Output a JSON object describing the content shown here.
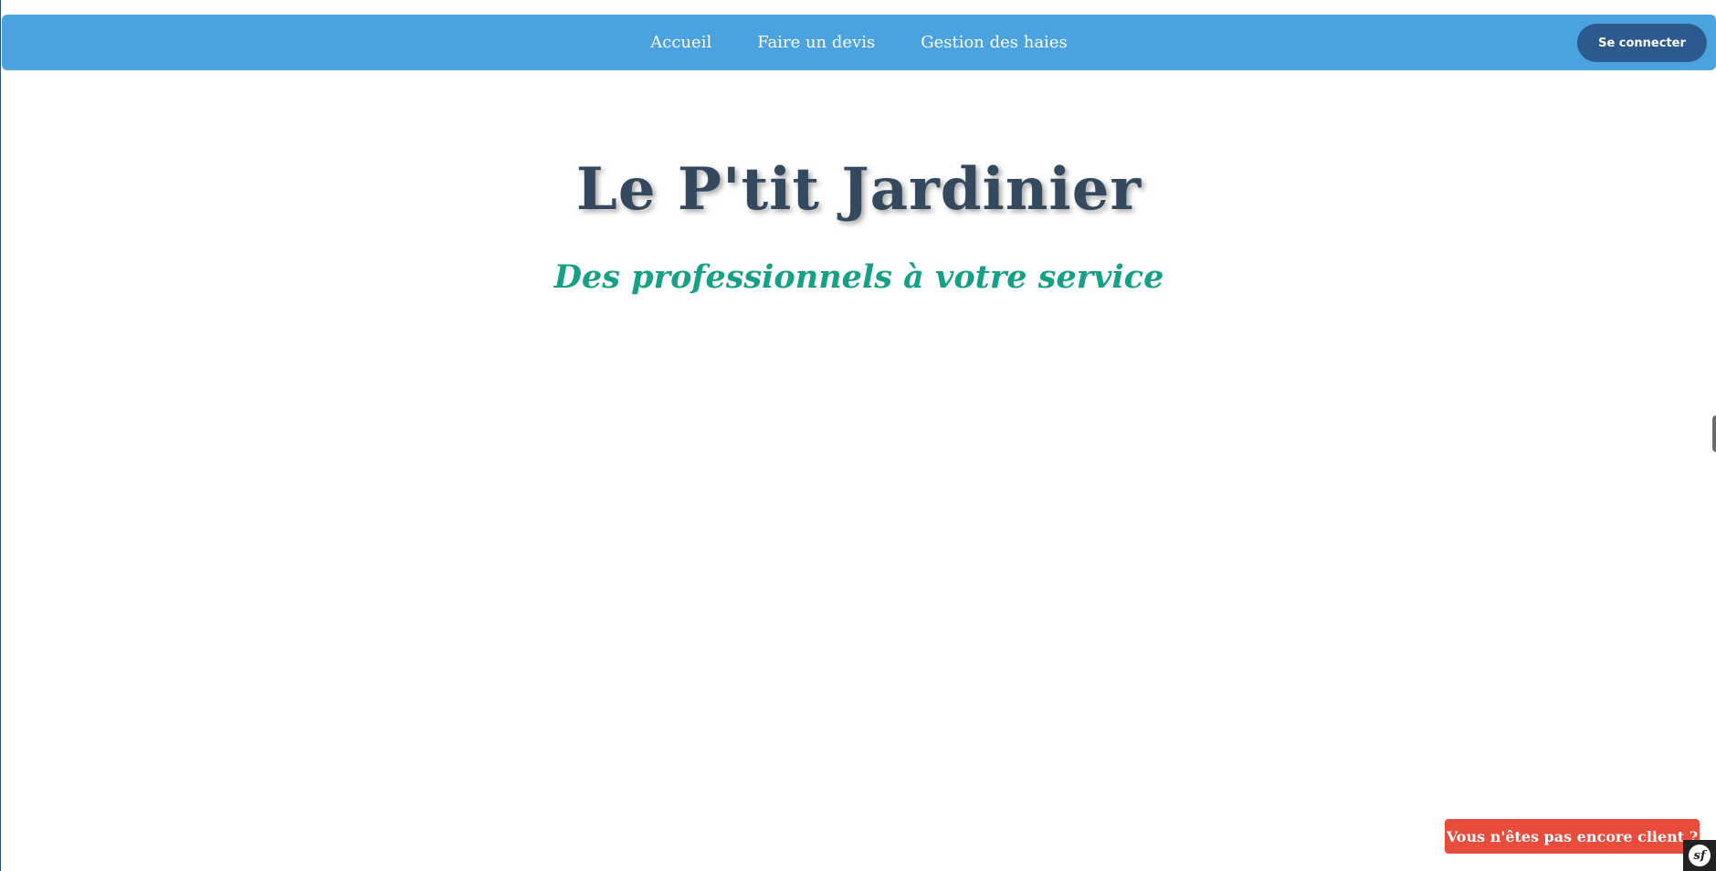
{
  "nav": {
    "links": [
      "Accueil",
      "Faire un devis",
      "Gestion des haies"
    ],
    "login_label": "Se connecter"
  },
  "hero": {
    "title": "Le P'tit Jardinier",
    "subtitle": "Des professionnels à votre service"
  },
  "cta": {
    "label": "Vous n'êtes pas encore client ?"
  },
  "toolbar": {
    "logo_text": "sf"
  },
  "colors": {
    "navbar": "#4aa3df",
    "login_button": "#2c5a8e",
    "title": "#34495e",
    "subtitle": "#16a085",
    "cta": "#e74c3c"
  },
  "icons": [
    "symfony-icon"
  ]
}
